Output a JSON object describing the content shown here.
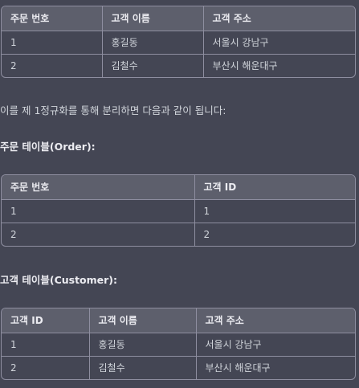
{
  "table1": {
    "headers": [
      "주문 번호",
      "고객 이름",
      "고객 주소"
    ],
    "rows": [
      [
        "1",
        "홍길동",
        "서울시 강남구"
      ],
      [
        "2",
        "김철수",
        "부산시 해운대구"
      ]
    ]
  },
  "paragraph": "이를 제 1정규화를 통해 분리하면 다음과 같이 됩니다:",
  "heading_order": "주문 테이블(Order):",
  "table_order": {
    "headers": [
      "주문 번호",
      "고객 ID"
    ],
    "rows": [
      [
        "1",
        "1"
      ],
      [
        "2",
        "2"
      ]
    ]
  },
  "heading_customer": "고객 테이블(Customer):",
  "table_customer": {
    "headers": [
      "고객 ID",
      "고객 이름",
      "고객 주소"
    ],
    "rows": [
      [
        "1",
        "홍길동",
        "서울시 강남구"
      ],
      [
        "2",
        "김철수",
        "부산시 해운대구"
      ]
    ]
  }
}
